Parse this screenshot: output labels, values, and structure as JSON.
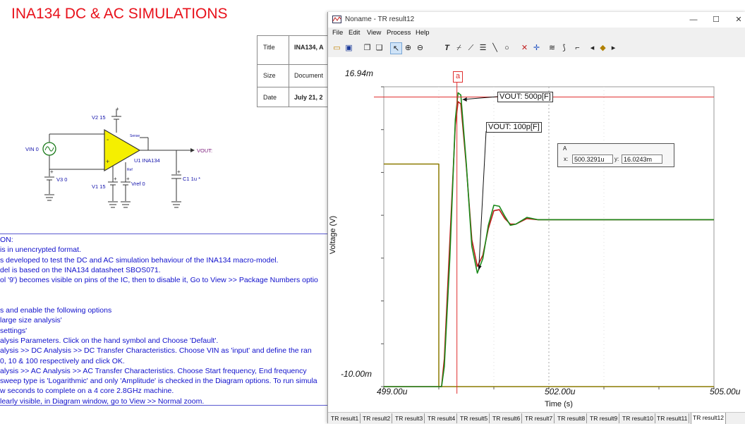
{
  "schematic": {
    "page_title": "INA134 DC & AC SIMULATIONS",
    "title_block": {
      "title_key": "Title",
      "title_value": "INA134, A",
      "size_key": "Size",
      "size_value": "Document",
      "date_key": "Date",
      "date_value": "July 21, 2"
    },
    "components": {
      "v2": "V2 15",
      "vin": "VIN 0",
      "v3": "V3 0",
      "v1": "V1 15",
      "vref": "Vref 0",
      "u1": "U1 INA134",
      "c1": "C1 1u *",
      "vout": "VOUT:",
      "sense": "Sense",
      "ref": "Ref"
    },
    "description_lines": [
      "ON:",
      " is in unencrypted format.",
      "s developed to test the DC and AC simulation behaviour of the INA134 macro-model.",
      "del is based on the INA134 datasheet SBOS071.",
      "ol '9') becomes visible on pins of the IC, then to disable it, Go to View >> Package Numbers optio",
      "",
      "",
      "s and enable the following options",
      "large size analysis'",
      " settings'",
      "alysis Parameters. Click on the hand symbol and Choose 'Default'.",
      "alysis >> DC Analysis >> DC Transfer Characteristics. Choose VIN as 'input' and define the ran",
      "0, 10 & 100 respectively and click OK.",
      "alysis >> AC Analysis >> AC Transfer Characteristics. Choose Start frequency, End frequency",
      "sweep type is 'Logarithmic' and only 'Amplitude' is checked in the Diagram options. To run simula",
      "w seconds to complete on a 4 core 2.8GHz machine.",
      "learly visible, in Diagram window, go to View >> Normal zoom."
    ]
  },
  "window": {
    "title": "Noname - TR result12",
    "controls": {
      "minimize": "—",
      "maximize": "☐",
      "close": "✕"
    },
    "menu": [
      "File",
      "Edit",
      "View",
      "Process",
      "Help"
    ],
    "cursor_panel": {
      "header": "A",
      "x_label": "x:",
      "x_value": "500.3291u",
      "y_label": "y:",
      "y_value": "16.0243m"
    },
    "annotations": {
      "marker": "a",
      "label_500p": "VOUT: 500p[F]",
      "label_100p": "VOUT: 100p[F]"
    },
    "tabs": [
      "TR result1",
      "TR result2",
      "TR result3",
      "TR result4",
      "TR result5",
      "TR result6",
      "TR result7",
      "TR result8",
      "TR result9",
      "TR result10",
      "TR result11",
      "TR result12"
    ],
    "active_tab": "TR result12"
  },
  "chart_data": {
    "type": "line",
    "xlabel": "Time (s)",
    "ylabel": "Voltage (V)",
    "x_ticks": [
      "499.00u",
      "502.00u",
      "505.00u"
    ],
    "y_ticks": [
      "16.94m",
      "-10.00m"
    ],
    "xlim": [
      499.0,
      505.0
    ],
    "ylim": [
      -10.0,
      16.94
    ],
    "x_unit": "us",
    "y_unit": "mV",
    "cursor_x": 500.3291,
    "cursor_y": 16.0243,
    "grid": true,
    "colors": {
      "input_step": "#8c7a00",
      "vout_500p": "#c01818",
      "vout_100p": "#1a8a1a",
      "cursor": "#e03030"
    },
    "series": [
      {
        "name": "",
        "color_key": "input_step",
        "x": [
          499.0,
          500.0,
          500.0,
          505.0
        ],
        "y": [
          10.0,
          10.0,
          -10.0,
          -10.0
        ]
      },
      {
        "name": "VOUT: 500p[F]",
        "color_key": "vout_500p",
        "x": [
          499.0,
          500.0,
          500.05,
          500.1,
          500.2,
          500.3,
          500.35,
          500.4,
          500.5,
          500.6,
          500.7,
          500.8,
          500.9,
          501.0,
          501.1,
          501.2,
          501.3,
          501.4,
          501.6,
          501.8,
          502.0,
          503.0,
          505.0
        ],
        "y": [
          -10.0,
          -10.0,
          -10.0,
          -7.5,
          3.0,
          13.5,
          15.6,
          15.4,
          9.8,
          3.2,
          0.8,
          1.8,
          4.2,
          5.8,
          5.9,
          5.1,
          4.6,
          4.6,
          5.1,
          5.0,
          5.0,
          5.0,
          5.0
        ]
      },
      {
        "name": "VOUT: 100p[F]",
        "color_key": "vout_100p",
        "x": [
          499.0,
          500.0,
          500.05,
          500.1,
          500.2,
          500.3,
          500.35,
          500.4,
          500.5,
          500.6,
          500.7,
          500.8,
          500.9,
          501.0,
          501.1,
          501.2,
          501.3,
          501.4,
          501.6,
          501.8,
          502.0,
          503.0,
          505.0
        ],
        "y": [
          -10.0,
          -10.0,
          -10.0,
          -8.2,
          1.5,
          14.0,
          16.4,
          16.2,
          10.0,
          2.6,
          0.2,
          1.5,
          4.5,
          6.3,
          6.2,
          5.3,
          4.5,
          4.6,
          5.2,
          5.0,
          5.0,
          5.0,
          5.0
        ]
      }
    ]
  }
}
